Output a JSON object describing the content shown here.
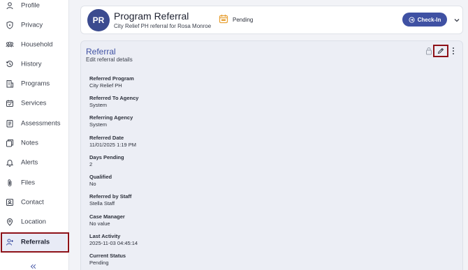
{
  "sidebar": {
    "items": [
      {
        "label": "Profile",
        "icon": "user-icon"
      },
      {
        "label": "Privacy",
        "icon": "shield-icon"
      },
      {
        "label": "Household",
        "icon": "people-icon"
      },
      {
        "label": "History",
        "icon": "history-icon"
      },
      {
        "label": "Programs",
        "icon": "building-icon"
      },
      {
        "label": "Services",
        "icon": "calendar-check-icon"
      },
      {
        "label": "Assessments",
        "icon": "clipboard-icon"
      },
      {
        "label": "Notes",
        "icon": "notes-icon"
      },
      {
        "label": "Alerts",
        "icon": "bell-icon"
      },
      {
        "label": "Files",
        "icon": "paperclip-icon"
      },
      {
        "label": "Contact",
        "icon": "contact-card-icon"
      },
      {
        "label": "Location",
        "icon": "location-pin-icon"
      },
      {
        "label": "Referrals",
        "icon": "user-plus-icon"
      }
    ],
    "active": "Referrals"
  },
  "header": {
    "avatar_initials": "PR",
    "title": "Program Referral",
    "subtitle": "City Relief PH referral for Rosa Monroe",
    "status": "Pending",
    "checkin_label": "Check-In"
  },
  "referral": {
    "title": "Referral",
    "subtitle": "Edit referral details",
    "fields": [
      {
        "label": "Referred Program",
        "value": "City Relief PH"
      },
      {
        "label": "Referred To Agency",
        "value": "System"
      },
      {
        "label": "Referring Agency",
        "value": "System"
      },
      {
        "label": "Referred Date",
        "value": "11/01/2025 1:19 PM"
      },
      {
        "label": "Days Pending",
        "value": "2"
      },
      {
        "label": "Qualified",
        "value": "No"
      },
      {
        "label": "Referred by Staff",
        "value": "Stella Staff"
      },
      {
        "label": "Case Manager",
        "value": "No value"
      },
      {
        "label": "Last Activity",
        "value": "2025-11-03 04:45:14"
      },
      {
        "label": "Current Status",
        "value": "Pending"
      }
    ]
  },
  "colors": {
    "accent": "#3f51a3",
    "highlight_box": "#8e1118",
    "status_pending": "#e8a33a"
  }
}
